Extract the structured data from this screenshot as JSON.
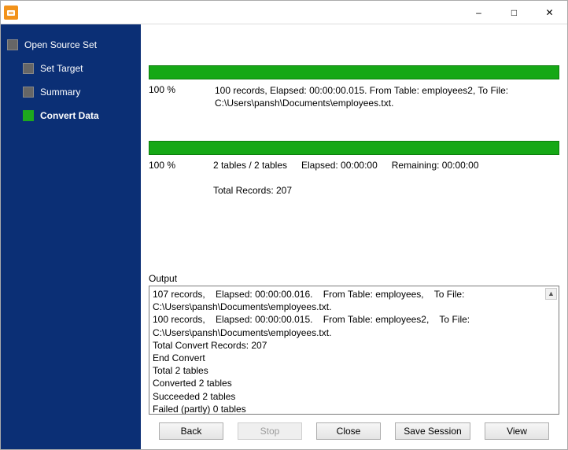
{
  "window": {
    "title": ""
  },
  "sidebar": {
    "items": [
      {
        "label": "Open Source Set",
        "active": false,
        "level": 0
      },
      {
        "label": "Set Target",
        "active": false,
        "level": 1
      },
      {
        "label": "Summary",
        "active": false,
        "level": 1
      },
      {
        "label": "Convert Data",
        "active": true,
        "level": 1
      }
    ]
  },
  "progress1": {
    "pct": "100 %",
    "detail": "100 records,    Elapsed: 00:00:00.015.    From Table: employees2,    To File: C:\\Users\\pansh\\Documents\\employees.txt."
  },
  "progress2": {
    "pct": "100 %",
    "tables": "2 tables / 2 tables",
    "elapsed": "Elapsed: 00:00:00",
    "remaining": "Remaining: 00:00:00",
    "total": "Total Records: 207"
  },
  "output": {
    "label": "Output",
    "lines": [
      "107 records,    Elapsed: 00:00:00.016.    From Table: employees,    To File: C:\\Users\\pansh\\Documents\\employees.txt.",
      "100 records,    Elapsed: 00:00:00.015.    From Table: employees2,    To File: C:\\Users\\pansh\\Documents\\employees.txt.",
      "Total Convert Records: 207",
      "End Convert",
      "Total 2 tables",
      "Converted 2 tables",
      "Succeeded 2 tables",
      "Failed (partly) 0 tables"
    ]
  },
  "buttons": {
    "back": "Back",
    "stop": "Stop",
    "close": "Close",
    "save_session": "Save Session",
    "view": "View"
  }
}
